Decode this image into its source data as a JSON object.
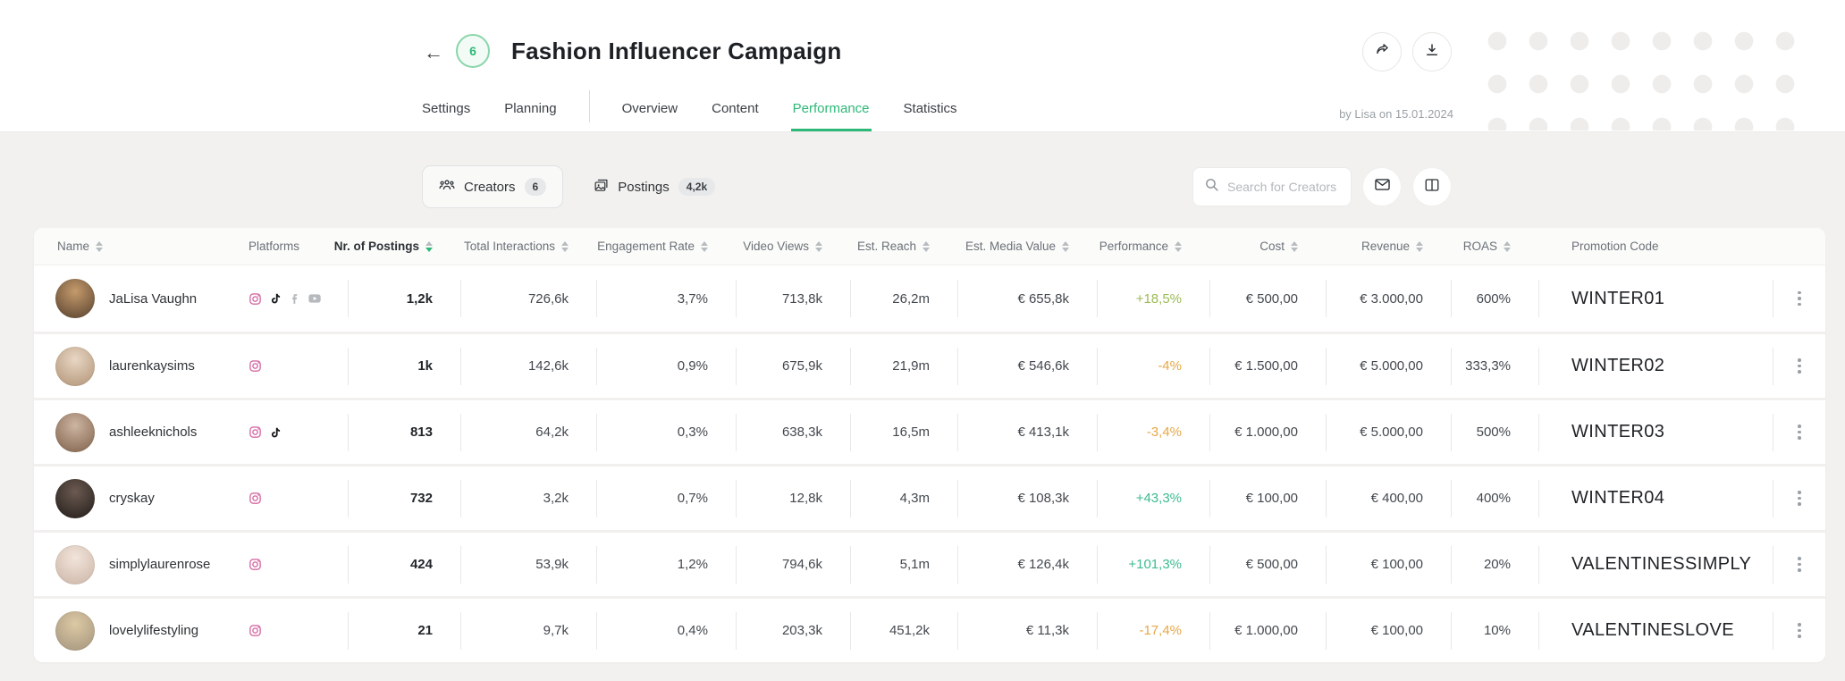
{
  "colors": {
    "accent_green": "#2eb877",
    "positive": "#3cbc8d",
    "lime": "#9cba55",
    "negative": "#e6a847",
    "instagram_pink": "#d56ba3"
  },
  "topbar": {
    "back_icon": "←",
    "badge_count": "6",
    "title": "Fashion Influencer Campaign",
    "byline": "by Lisa on 15.01.2024",
    "tabs_left": [
      {
        "label": "Settings"
      },
      {
        "label": "Planning"
      }
    ],
    "tabs_right": [
      {
        "label": "Overview"
      },
      {
        "label": "Content"
      },
      {
        "label": "Performance",
        "active": true
      },
      {
        "label": "Statistics"
      }
    ]
  },
  "toolbar": {
    "creators_label": "Creators",
    "creators_count": "6",
    "postings_label": "Postings",
    "postings_count": "4,2k",
    "search_placeholder": "Search for Creators"
  },
  "table": {
    "columns": [
      {
        "key": "name",
        "label": "Name",
        "align": "left",
        "sortable": true
      },
      {
        "key": "platforms",
        "label": "Platforms",
        "align": "left"
      },
      {
        "key": "postings",
        "label": "Nr. of Postings",
        "align": "right",
        "sortable": true,
        "sorted": "desc"
      },
      {
        "key": "interactions",
        "label": "Total Interactions",
        "align": "right",
        "sortable": true
      },
      {
        "key": "engagement",
        "label": "Engagement Rate",
        "align": "right",
        "sortable": true
      },
      {
        "key": "video_views",
        "label": "Video Views",
        "align": "right",
        "sortable": true
      },
      {
        "key": "reach",
        "label": "Est. Reach",
        "align": "right",
        "sortable": true
      },
      {
        "key": "media_value",
        "label": "Est. Media Value",
        "align": "right",
        "sortable": true
      },
      {
        "key": "performance",
        "label": "Performance",
        "align": "right",
        "sortable": true
      },
      {
        "key": "cost",
        "label": "Cost",
        "align": "right",
        "sortable": true
      },
      {
        "key": "revenue",
        "label": "Revenue",
        "align": "right",
        "sortable": true
      },
      {
        "key": "roas",
        "label": "ROAS",
        "align": "right",
        "sortable": true
      },
      {
        "key": "promo",
        "label": "Promotion Code",
        "align": "left"
      },
      {
        "key": "menu",
        "label": "",
        "align": "center"
      }
    ],
    "rows": [
      {
        "name": "JaLisa Vaughn",
        "platforms": [
          "instagram",
          "tiktok",
          "facebook",
          "youtube"
        ],
        "postings": "1,2k",
        "interactions": "726,6k",
        "engagement": "3,7%",
        "video_views": "713,8k",
        "reach": "26,2m",
        "media_value": "€ 655,8k",
        "performance": "+18,5%",
        "performance_tone": "lime",
        "cost": "€ 500,00",
        "revenue": "€ 3.000,00",
        "roas": "600%",
        "promo": "WINTER01",
        "avatar": [
          "#c59a6b",
          "#55402e"
        ]
      },
      {
        "name": "laurenkaysims",
        "platforms": [
          "instagram"
        ],
        "postings": "1k",
        "interactions": "142,6k",
        "engagement": "0,9%",
        "video_views": "675,9k",
        "reach": "21,9m",
        "media_value": "€ 546,6k",
        "performance": "-4%",
        "performance_tone": "negative",
        "cost": "€ 1.500,00",
        "revenue": "€ 5.000,00",
        "roas": "333,3%",
        "promo": "WINTER02",
        "avatar": [
          "#e8d6c4",
          "#b09274"
        ]
      },
      {
        "name": "ashleeknichols",
        "platforms": [
          "instagram",
          "tiktok"
        ],
        "postings": "813",
        "interactions": "64,2k",
        "engagement": "0,3%",
        "video_views": "638,3k",
        "reach": "16,5m",
        "media_value": "€ 413,1k",
        "performance": "-3,4%",
        "performance_tone": "negative",
        "cost": "€ 1.000,00",
        "revenue": "€ 5.000,00",
        "roas": "500%",
        "promo": "WINTER03",
        "avatar": [
          "#cdb5a2",
          "#7e6049"
        ]
      },
      {
        "name": "cryskay",
        "platforms": [
          "instagram"
        ],
        "postings": "732",
        "interactions": "3,2k",
        "engagement": "0,7%",
        "video_views": "12,8k",
        "reach": "4,3m",
        "media_value": "€ 108,3k",
        "performance": "+43,3%",
        "performance_tone": "positive",
        "cost": "€ 100,00",
        "revenue": "€ 400,00",
        "roas": "400%",
        "promo": "WINTER04",
        "avatar": [
          "#6b5a51",
          "#221c19"
        ]
      },
      {
        "name": "simplylaurenrose",
        "platforms": [
          "instagram"
        ],
        "postings": "424",
        "interactions": "53,9k",
        "engagement": "1,2%",
        "video_views": "794,6k",
        "reach": "5,1m",
        "media_value": "€ 126,4k",
        "performance": "+101,3%",
        "performance_tone": "positive",
        "cost": "€ 500,00",
        "revenue": "€ 100,00",
        "roas": "20%",
        "promo": "VALENTINESSIMPLY",
        "avatar": [
          "#f2e4da",
          "#cbb4a6"
        ]
      },
      {
        "name": "lovelylifestyling",
        "platforms": [
          "instagram"
        ],
        "postings": "21",
        "interactions": "9,7k",
        "engagement": "0,4%",
        "video_views": "203,3k",
        "reach": "451,2k",
        "media_value": "€ 11,3k",
        "performance": "-17,4%",
        "performance_tone": "negative",
        "cost": "€ 1.000,00",
        "revenue": "€ 100,00",
        "roas": "10%",
        "promo": "VALENTINESLOVE",
        "avatar": [
          "#dcc9a4",
          "#a2937c"
        ]
      }
    ]
  }
}
